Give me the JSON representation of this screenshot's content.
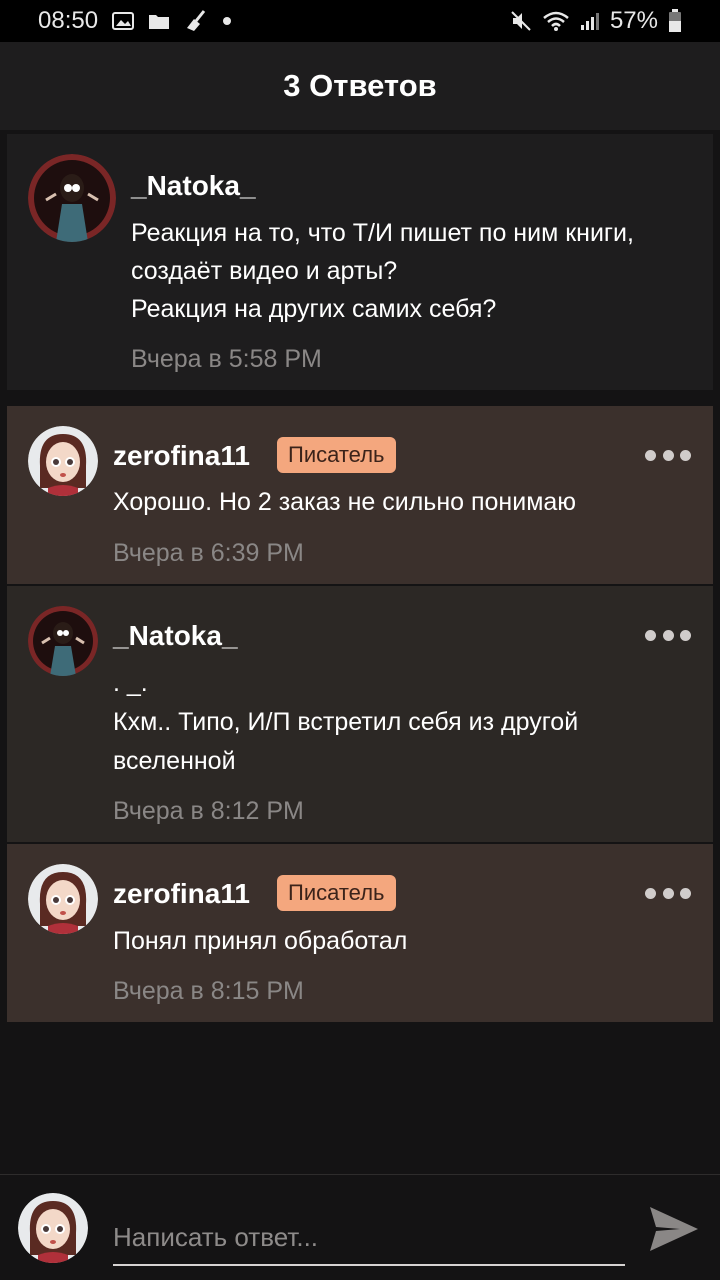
{
  "status_bar": {
    "time": "08:50",
    "battery": "57%",
    "left_icons": [
      "image-icon",
      "folder-icon",
      "broom-icon",
      "dot-icon"
    ],
    "right_icons": [
      "mute-icon",
      "wifi-icon",
      "signal-icon",
      "battery-icon"
    ]
  },
  "header": {
    "title": "3 Ответов"
  },
  "root_comment": {
    "username": "_Natoka_",
    "text_line1": "Реакция на то, что Т/И пишет по ним книги,",
    "text_line2": "создаёт видео и арты?",
    "text_line3": "Реакция на других самих себя?",
    "time": "Вчера в 5:58 PM"
  },
  "replies": [
    {
      "username": "zerofina11",
      "badge": "Писатель",
      "text_line1": "Хорошо. Но 2 заказ не сильно понимаю",
      "time": "Вчера в 6:39 PM"
    },
    {
      "username": "_Natoka_",
      "text_line1": ". _.",
      "text_line2": "Кхм.. Типо, И/П встретил себя из другой",
      "text_line3": "вселенной",
      "time": "Вчера в 8:12 PM"
    },
    {
      "username": "zerofina11",
      "badge": "Писатель",
      "text_line1": "Понял принял обработал",
      "time": "Вчера в 8:15 PM"
    }
  ],
  "input": {
    "placeholder": "Написать ответ..."
  },
  "colors": {
    "background": "#141314",
    "header": "#1e1d1e",
    "writer_reply_bg": "#3b302c",
    "plain_reply_bg": "#2c2825",
    "badge": "#f4a77e",
    "timestamp": "#8a8786"
  }
}
